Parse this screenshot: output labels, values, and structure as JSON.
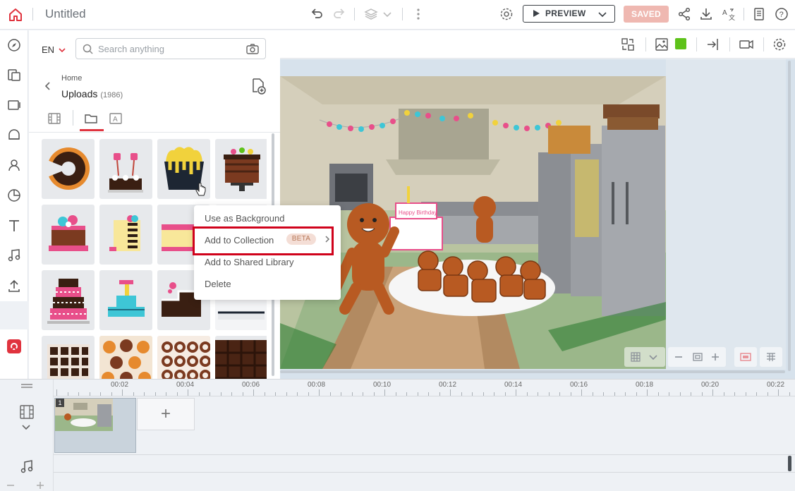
{
  "topbar": {
    "title": "Untitled",
    "preview_label": "PREVIEW",
    "saved_label": "SAVED",
    "icons": [
      "home-icon",
      "undo-icon",
      "redo-icon",
      "layers-icon",
      "more-icon",
      "settings-icon",
      "share-icon",
      "download-icon",
      "translate-icon",
      "notes-icon",
      "help-icon"
    ]
  },
  "rail": {
    "icons": [
      "compass-icon",
      "templates-icon",
      "scenes-icon",
      "characters-icon",
      "user-icon",
      "chart-icon",
      "text-icon",
      "music-icon",
      "upload-icon",
      "brand-icon"
    ]
  },
  "panel": {
    "language": "EN",
    "search_placeholder": "Search anything",
    "breadcrumb_home": "Home",
    "breadcrumb_current": "Uploads",
    "breadcrumb_count": "(1986)",
    "tabs": [
      "video-tab",
      "folder-tab",
      "image-tab"
    ]
  },
  "context_menu": {
    "items": [
      "Use as Background",
      "Add to Collection",
      "Add to Shared Library",
      "Delete"
    ],
    "beta_label": "BETA"
  },
  "canvas": {
    "banner_text": "Happy Birthday",
    "accent": "#5ec21a"
  },
  "timeline": {
    "ticks": [
      "00:02",
      "00:04",
      "00:06",
      "00:08",
      "00:10",
      "00:12",
      "00:14",
      "00:16",
      "00:18",
      "00:20",
      "00:22"
    ],
    "scene_number": "1",
    "add_label": "+"
  },
  "colors": {
    "brand": "#e0333e",
    "highlight": "#d0021b",
    "saved": "#efb8b1"
  }
}
